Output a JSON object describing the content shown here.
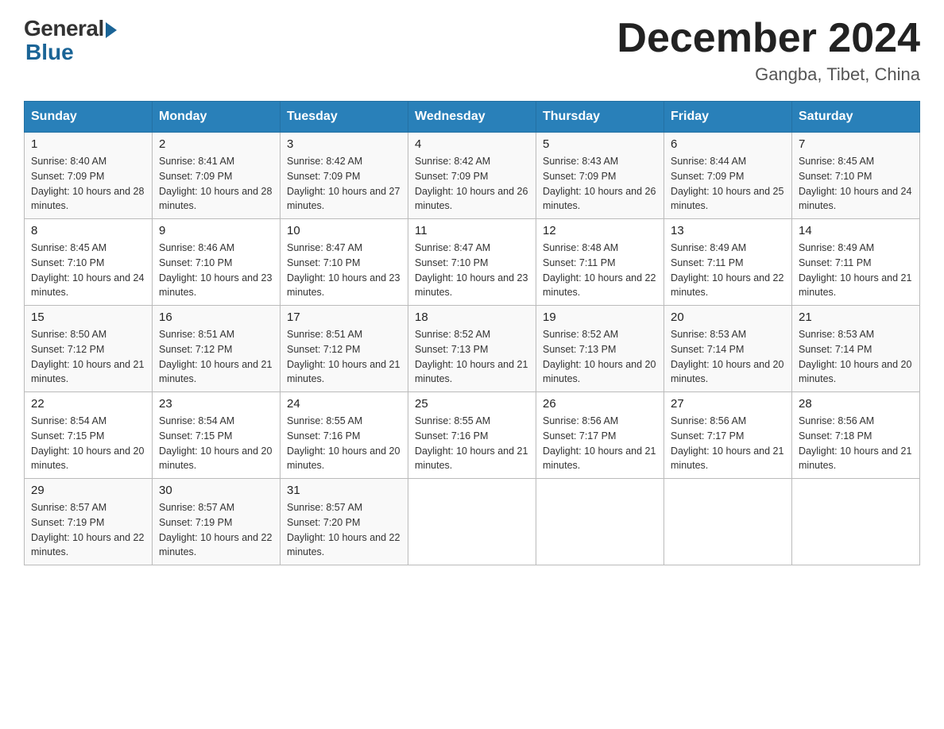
{
  "header": {
    "logo_general": "General",
    "logo_blue": "Blue",
    "month_title": "December 2024",
    "location": "Gangba, Tibet, China"
  },
  "days_of_week": [
    "Sunday",
    "Monday",
    "Tuesday",
    "Wednesday",
    "Thursday",
    "Friday",
    "Saturday"
  ],
  "weeks": [
    [
      {
        "day": "1",
        "sunrise": "Sunrise: 8:40 AM",
        "sunset": "Sunset: 7:09 PM",
        "daylight": "Daylight: 10 hours and 28 minutes."
      },
      {
        "day": "2",
        "sunrise": "Sunrise: 8:41 AM",
        "sunset": "Sunset: 7:09 PM",
        "daylight": "Daylight: 10 hours and 28 minutes."
      },
      {
        "day": "3",
        "sunrise": "Sunrise: 8:42 AM",
        "sunset": "Sunset: 7:09 PM",
        "daylight": "Daylight: 10 hours and 27 minutes."
      },
      {
        "day": "4",
        "sunrise": "Sunrise: 8:42 AM",
        "sunset": "Sunset: 7:09 PM",
        "daylight": "Daylight: 10 hours and 26 minutes."
      },
      {
        "day": "5",
        "sunrise": "Sunrise: 8:43 AM",
        "sunset": "Sunset: 7:09 PM",
        "daylight": "Daylight: 10 hours and 26 minutes."
      },
      {
        "day": "6",
        "sunrise": "Sunrise: 8:44 AM",
        "sunset": "Sunset: 7:09 PM",
        "daylight": "Daylight: 10 hours and 25 minutes."
      },
      {
        "day": "7",
        "sunrise": "Sunrise: 8:45 AM",
        "sunset": "Sunset: 7:10 PM",
        "daylight": "Daylight: 10 hours and 24 minutes."
      }
    ],
    [
      {
        "day": "8",
        "sunrise": "Sunrise: 8:45 AM",
        "sunset": "Sunset: 7:10 PM",
        "daylight": "Daylight: 10 hours and 24 minutes."
      },
      {
        "day": "9",
        "sunrise": "Sunrise: 8:46 AM",
        "sunset": "Sunset: 7:10 PM",
        "daylight": "Daylight: 10 hours and 23 minutes."
      },
      {
        "day": "10",
        "sunrise": "Sunrise: 8:47 AM",
        "sunset": "Sunset: 7:10 PM",
        "daylight": "Daylight: 10 hours and 23 minutes."
      },
      {
        "day": "11",
        "sunrise": "Sunrise: 8:47 AM",
        "sunset": "Sunset: 7:10 PM",
        "daylight": "Daylight: 10 hours and 23 minutes."
      },
      {
        "day": "12",
        "sunrise": "Sunrise: 8:48 AM",
        "sunset": "Sunset: 7:11 PM",
        "daylight": "Daylight: 10 hours and 22 minutes."
      },
      {
        "day": "13",
        "sunrise": "Sunrise: 8:49 AM",
        "sunset": "Sunset: 7:11 PM",
        "daylight": "Daylight: 10 hours and 22 minutes."
      },
      {
        "day": "14",
        "sunrise": "Sunrise: 8:49 AM",
        "sunset": "Sunset: 7:11 PM",
        "daylight": "Daylight: 10 hours and 21 minutes."
      }
    ],
    [
      {
        "day": "15",
        "sunrise": "Sunrise: 8:50 AM",
        "sunset": "Sunset: 7:12 PM",
        "daylight": "Daylight: 10 hours and 21 minutes."
      },
      {
        "day": "16",
        "sunrise": "Sunrise: 8:51 AM",
        "sunset": "Sunset: 7:12 PM",
        "daylight": "Daylight: 10 hours and 21 minutes."
      },
      {
        "day": "17",
        "sunrise": "Sunrise: 8:51 AM",
        "sunset": "Sunset: 7:12 PM",
        "daylight": "Daylight: 10 hours and 21 minutes."
      },
      {
        "day": "18",
        "sunrise": "Sunrise: 8:52 AM",
        "sunset": "Sunset: 7:13 PM",
        "daylight": "Daylight: 10 hours and 21 minutes."
      },
      {
        "day": "19",
        "sunrise": "Sunrise: 8:52 AM",
        "sunset": "Sunset: 7:13 PM",
        "daylight": "Daylight: 10 hours and 20 minutes."
      },
      {
        "day": "20",
        "sunrise": "Sunrise: 8:53 AM",
        "sunset": "Sunset: 7:14 PM",
        "daylight": "Daylight: 10 hours and 20 minutes."
      },
      {
        "day": "21",
        "sunrise": "Sunrise: 8:53 AM",
        "sunset": "Sunset: 7:14 PM",
        "daylight": "Daylight: 10 hours and 20 minutes."
      }
    ],
    [
      {
        "day": "22",
        "sunrise": "Sunrise: 8:54 AM",
        "sunset": "Sunset: 7:15 PM",
        "daylight": "Daylight: 10 hours and 20 minutes."
      },
      {
        "day": "23",
        "sunrise": "Sunrise: 8:54 AM",
        "sunset": "Sunset: 7:15 PM",
        "daylight": "Daylight: 10 hours and 20 minutes."
      },
      {
        "day": "24",
        "sunrise": "Sunrise: 8:55 AM",
        "sunset": "Sunset: 7:16 PM",
        "daylight": "Daylight: 10 hours and 20 minutes."
      },
      {
        "day": "25",
        "sunrise": "Sunrise: 8:55 AM",
        "sunset": "Sunset: 7:16 PM",
        "daylight": "Daylight: 10 hours and 21 minutes."
      },
      {
        "day": "26",
        "sunrise": "Sunrise: 8:56 AM",
        "sunset": "Sunset: 7:17 PM",
        "daylight": "Daylight: 10 hours and 21 minutes."
      },
      {
        "day": "27",
        "sunrise": "Sunrise: 8:56 AM",
        "sunset": "Sunset: 7:17 PM",
        "daylight": "Daylight: 10 hours and 21 minutes."
      },
      {
        "day": "28",
        "sunrise": "Sunrise: 8:56 AM",
        "sunset": "Sunset: 7:18 PM",
        "daylight": "Daylight: 10 hours and 21 minutes."
      }
    ],
    [
      {
        "day": "29",
        "sunrise": "Sunrise: 8:57 AM",
        "sunset": "Sunset: 7:19 PM",
        "daylight": "Daylight: 10 hours and 22 minutes."
      },
      {
        "day": "30",
        "sunrise": "Sunrise: 8:57 AM",
        "sunset": "Sunset: 7:19 PM",
        "daylight": "Daylight: 10 hours and 22 minutes."
      },
      {
        "day": "31",
        "sunrise": "Sunrise: 8:57 AM",
        "sunset": "Sunset: 7:20 PM",
        "daylight": "Daylight: 10 hours and 22 minutes."
      },
      null,
      null,
      null,
      null
    ]
  ]
}
